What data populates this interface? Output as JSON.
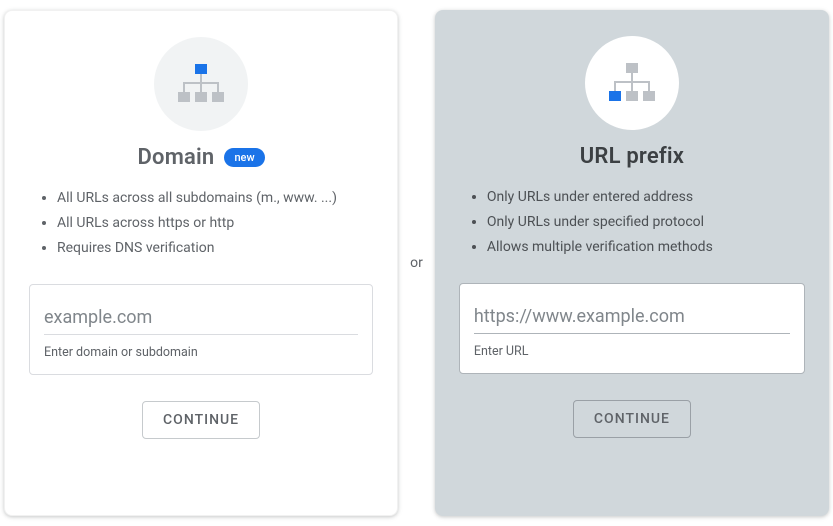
{
  "separator": "or",
  "domain_card": {
    "title": "Domain",
    "badge": "new",
    "bullets": [
      "All URLs across all subdomains (m., www. ...)",
      "All URLs across https or http",
      "Requires DNS verification"
    ],
    "input": {
      "value": "example.com",
      "helper": "Enter domain or subdomain"
    },
    "cta": "CONTINUE",
    "icon": {
      "highlight": "top"
    }
  },
  "url_card": {
    "title": "URL prefix",
    "bullets": [
      "Only URLs under entered address",
      "Only URLs under specified protocol",
      "Allows multiple verification methods"
    ],
    "input": {
      "value": "https://www.example.com",
      "helper": "Enter URL"
    },
    "cta": "CONTINUE",
    "icon": {
      "highlight": "bottom-left"
    }
  },
  "colors": {
    "accent": "#1a73e8",
    "icon_grey": "#bdc1c6"
  }
}
